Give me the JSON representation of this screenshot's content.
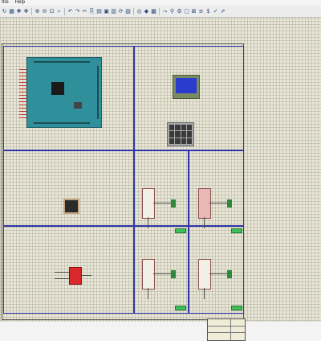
{
  "menu": {
    "items": [
      "Itre",
      "Help"
    ]
  },
  "toolbar": {
    "groups": [
      [
        {
          "icon": "refresh-icon",
          "glyph": "↻"
        },
        {
          "icon": "grid-icon",
          "glyph": "▦"
        },
        {
          "icon": "crosshair-icon",
          "glyph": "✚"
        },
        {
          "icon": "pan-icon",
          "glyph": "✥"
        }
      ],
      [
        {
          "icon": "zoom-in-icon",
          "glyph": "⊕"
        },
        {
          "icon": "zoom-out-icon",
          "glyph": "⊖"
        },
        {
          "icon": "zoom-fit-icon",
          "glyph": "⊡"
        },
        {
          "icon": "zoom-area-icon",
          "glyph": "⌕"
        }
      ],
      [
        {
          "icon": "undo-icon",
          "glyph": "↶"
        },
        {
          "icon": "redo-icon",
          "glyph": "↷"
        },
        {
          "icon": "cut-icon",
          "glyph": "✂"
        },
        {
          "icon": "copy-icon",
          "glyph": "⎘"
        },
        {
          "icon": "paste-icon",
          "glyph": "▤"
        },
        {
          "icon": "block-copy-icon",
          "glyph": "▣"
        },
        {
          "icon": "block-move-icon",
          "glyph": "▥"
        },
        {
          "icon": "block-rotate-icon",
          "glyph": "⟳"
        },
        {
          "icon": "block-delete-icon",
          "glyph": "▧"
        }
      ],
      [
        {
          "icon": "pick-device-icon",
          "glyph": "◎"
        },
        {
          "icon": "make-device-icon",
          "glyph": "◆"
        },
        {
          "icon": "package-icon",
          "glyph": "▩"
        }
      ],
      [
        {
          "icon": "wire-autorouter-icon",
          "glyph": "⤳"
        },
        {
          "icon": "search-icon",
          "glyph": "⚲"
        },
        {
          "icon": "property-tool-icon",
          "glyph": "⚙"
        },
        {
          "icon": "new-sheet-icon",
          "glyph": "▢"
        },
        {
          "icon": "remove-sheet-icon",
          "glyph": "⊠"
        },
        {
          "icon": "netlist-icon",
          "glyph": "≡"
        },
        {
          "icon": "bill-of-materials-icon",
          "glyph": "$"
        },
        {
          "icon": "electrical-check-icon",
          "glyph": "✓"
        },
        {
          "icon": "export-icon",
          "glyph": "⇗"
        }
      ]
    ]
  },
  "colors": {
    "canvas_bg": "#e9e6d6",
    "sheet_border": "#2f36a8",
    "arduino": "#2f8f9a",
    "lcd_screen": "#2a3bd0",
    "ic_pink": "#e7b8b4",
    "red_module": "#d8282b"
  }
}
